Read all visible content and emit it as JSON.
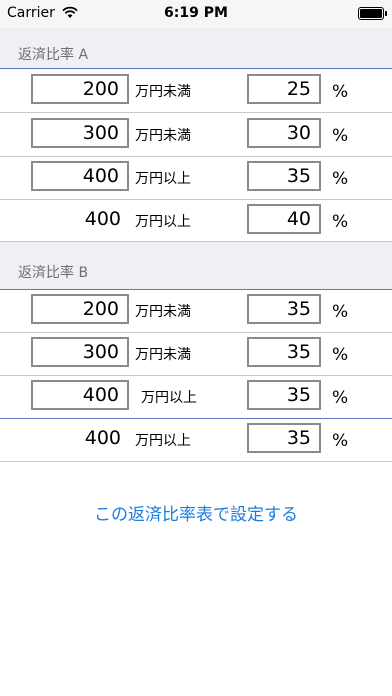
{
  "status": {
    "carrier": "Carrier",
    "time": "6:19 PM"
  },
  "section_a": {
    "title": "返済比率 A",
    "rows": [
      {
        "amount": "200",
        "unit": "万円未満",
        "percent": "25",
        "pct": "%"
      },
      {
        "amount": "300",
        "unit": "万円未満",
        "percent": "30",
        "pct": "%"
      },
      {
        "amount": "400",
        "unit": "万円以上",
        "percent": "35",
        "pct": "%"
      },
      {
        "amount": "400",
        "unit": "万円以上",
        "percent": "40",
        "pct": "%"
      }
    ]
  },
  "section_b": {
    "title": "返済比率 B",
    "rows": [
      {
        "amount": "200",
        "unit": "万円未満",
        "percent": "35",
        "pct": "%"
      },
      {
        "amount": "300",
        "unit": "万円未満",
        "percent": "35",
        "pct": "%"
      },
      {
        "amount": "400",
        "unit": "万円以上",
        "percent": "35",
        "pct": "%"
      },
      {
        "amount": "400",
        "unit": "万円以上",
        "percent": "35",
        "pct": "%"
      }
    ]
  },
  "action_label": "この返済比率表で設定する"
}
